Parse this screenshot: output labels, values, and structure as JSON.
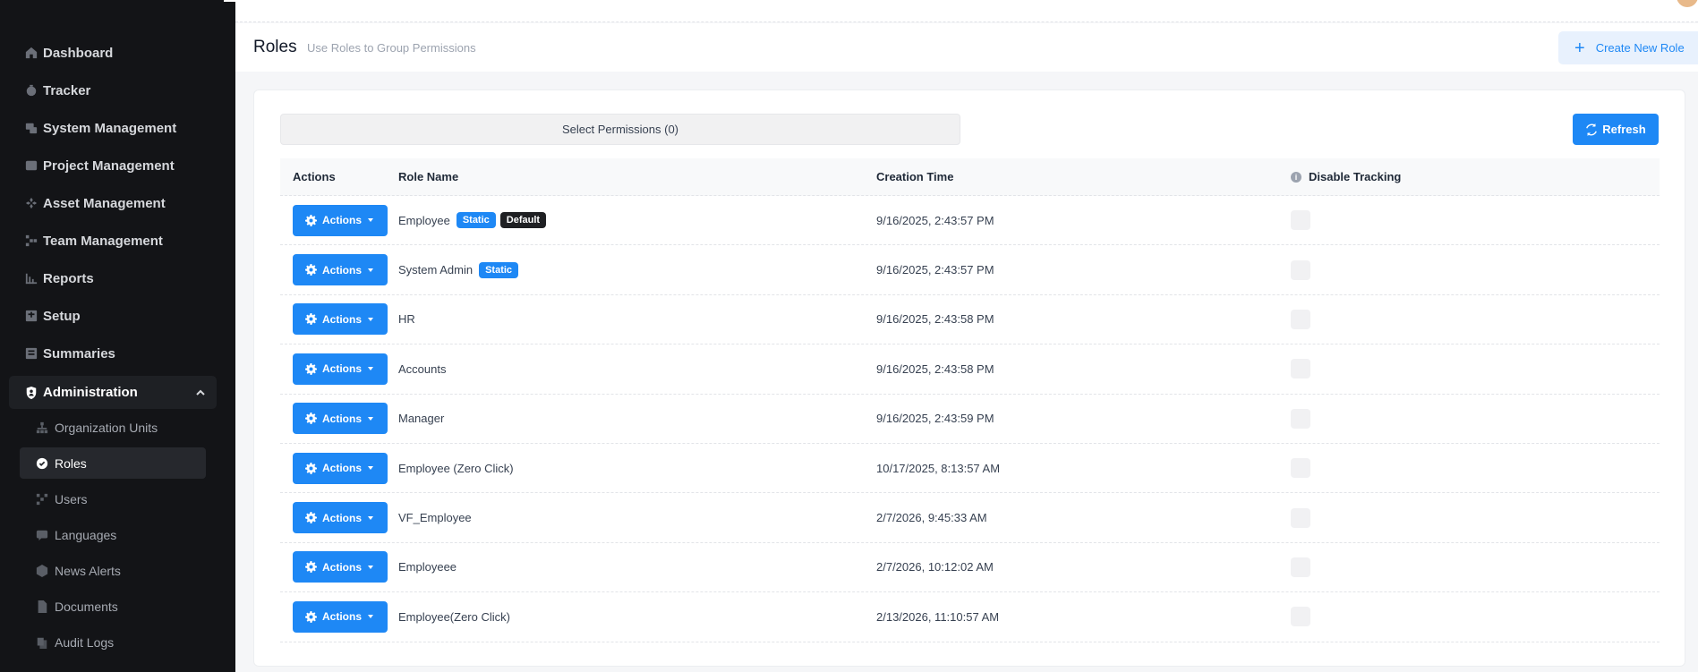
{
  "sidebar": {
    "items": [
      {
        "label": "Dashboard",
        "icon": "home-icon"
      },
      {
        "label": "Tracker",
        "icon": "tracker-icon"
      },
      {
        "label": "System Management",
        "icon": "system-icon"
      },
      {
        "label": "Project Management",
        "icon": "project-icon"
      },
      {
        "label": "Asset Management",
        "icon": "asset-icon"
      },
      {
        "label": "Team Management",
        "icon": "team-icon"
      },
      {
        "label": "Reports",
        "icon": "reports-icon"
      },
      {
        "label": "Setup",
        "icon": "setup-icon"
      },
      {
        "label": "Summaries",
        "icon": "summaries-icon"
      },
      {
        "label": "Administration",
        "icon": "shield-icon"
      }
    ],
    "subitems": [
      {
        "label": "Organization Units",
        "icon": "org-units-icon"
      },
      {
        "label": "Roles",
        "icon": "roles-icon"
      },
      {
        "label": "Users",
        "icon": "users-icon"
      },
      {
        "label": "Languages",
        "icon": "languages-icon"
      },
      {
        "label": "News Alerts",
        "icon": "news-alerts-icon"
      },
      {
        "label": "Documents",
        "icon": "documents-icon"
      },
      {
        "label": "Audit Logs",
        "icon": "audit-logs-icon"
      }
    ]
  },
  "header": {
    "title": "Roles",
    "subtitle": "Use Roles to Group Permissions",
    "create_label": "Create New Role"
  },
  "toolbar": {
    "permissions_label": "Select Permissions (0)",
    "refresh_label": "Refresh"
  },
  "table": {
    "columns": [
      "Actions",
      "Role Name",
      "Creation Time",
      "Disable Tracking"
    ],
    "action_label": "Actions",
    "badge_static": "Static",
    "badge_default": "Default",
    "rows": [
      {
        "name": "Employee",
        "time": "9/16/2025, 2:43:57 PM",
        "static": true,
        "default": true
      },
      {
        "name": "System Admin",
        "time": "9/16/2025, 2:43:57 PM",
        "static": true,
        "default": false
      },
      {
        "name": "HR",
        "time": "9/16/2025, 2:43:58 PM",
        "static": false,
        "default": false
      },
      {
        "name": "Accounts",
        "time": "9/16/2025, 2:43:58 PM",
        "static": false,
        "default": false
      },
      {
        "name": "Manager",
        "time": "9/16/2025, 2:43:59 PM",
        "static": false,
        "default": false
      },
      {
        "name": "Employee (Zero Click)",
        "time": "10/17/2025, 8:13:57 AM",
        "static": false,
        "default": false
      },
      {
        "name": "VF_Employee",
        "time": "2/7/2026, 9:45:33 AM",
        "static": false,
        "default": false
      },
      {
        "name": "Employeee",
        "time": "2/7/2026, 10:12:02 AM",
        "static": false,
        "default": false
      },
      {
        "name": "Employee(Zero Click)",
        "time": "2/13/2026, 11:10:57 AM",
        "static": false,
        "default": false
      }
    ]
  },
  "colors": {
    "accent": "#1e88f5",
    "sidebar_bg": "#131417"
  }
}
